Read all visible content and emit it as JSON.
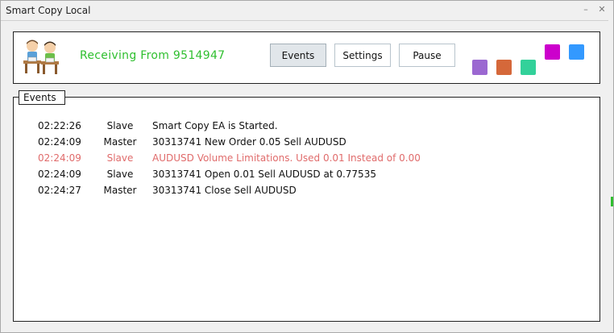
{
  "window": {
    "title": "Smart Copy Local",
    "minimize_glyph": "–",
    "close_glyph": "✕"
  },
  "header": {
    "status_text": "Receiving From 9514947",
    "status_color": "#2fbf2f",
    "buttons": {
      "events": "Events",
      "settings": "Settings",
      "pause": "Pause"
    },
    "active_button": "events",
    "swatches": [
      "#9b68d1",
      "#d5683a",
      "#33d19a",
      "#cc00cc",
      "#3399ff"
    ]
  },
  "events": {
    "legend": "Events",
    "rows": [
      {
        "time": "02:22:26",
        "source": "Slave",
        "message": "Smart Copy EA is Started.",
        "level": "normal"
      },
      {
        "time": "02:24:09",
        "source": "Master",
        "message": "30313741 New Order 0.05 Sell AUDUSD",
        "level": "normal"
      },
      {
        "time": "02:24:09",
        "source": "Slave",
        "message": "AUDUSD Volume Limitations. Used 0.01 Instead of 0.00",
        "level": "error"
      },
      {
        "time": "02:24:09",
        "source": "Slave",
        "message": "30313741 Open 0.01 Sell AUDUSD at 0.77535",
        "level": "normal"
      },
      {
        "time": "02:24:27",
        "source": "Master",
        "message": "30313741 Close Sell AUDUSD",
        "level": "normal"
      }
    ],
    "error_color": "#e06b6b"
  }
}
